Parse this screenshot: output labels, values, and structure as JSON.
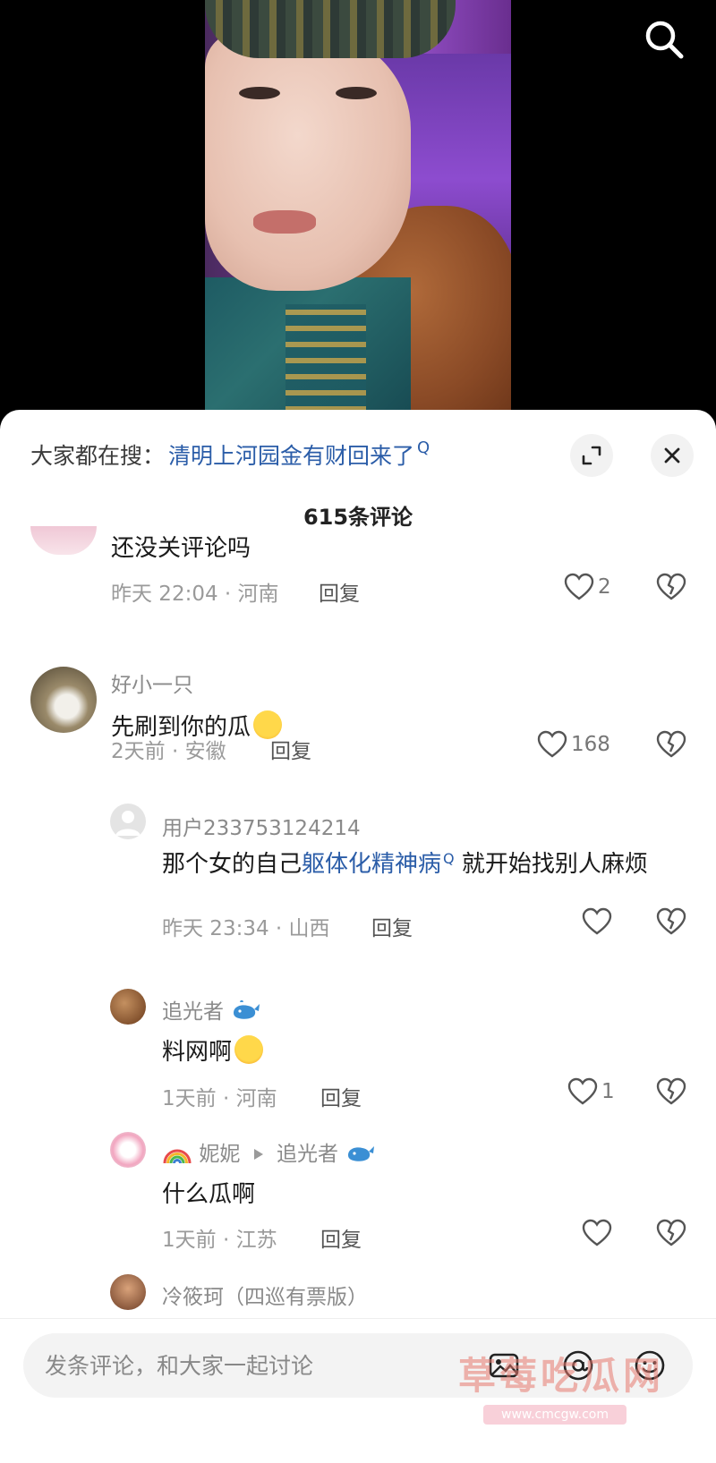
{
  "hot_search": {
    "prefix": "大家都在搜：",
    "term": "清明上河园金有财回来了",
    "search_glyph": "Q"
  },
  "comment_count": "615条评论",
  "comments": [
    {
      "text": "还没关评论吗",
      "time_location": "昨天 22:04 · 河南",
      "reply_label": "回复",
      "likes": "2"
    },
    {
      "username": "好小一只",
      "text": "先刷到你的瓜",
      "time_location": "2天前 · 安徽",
      "reply_label": "回复",
      "likes": "168",
      "replies": [
        {
          "username": "用户233753124214",
          "text_before": "那个女的自己",
          "text_link": "躯体化精神病",
          "text_after": " 就开始找别人麻烦",
          "time_location": "昨天 23:34 · 山西",
          "reply_label": "回复",
          "likes": ""
        },
        {
          "username": "追光者",
          "text": "料网啊",
          "time_location": "1天前 · 河南",
          "reply_label": "回复",
          "likes": "1"
        },
        {
          "username": "妮妮",
          "reply_to": "追光者",
          "text": "什么瓜啊",
          "time_location": "1天前 · 江苏",
          "reply_label": "回复",
          "likes": ""
        },
        {
          "username": "冷筱珂（四巡有票版）"
        }
      ]
    }
  ],
  "input": {
    "placeholder": "发条评论，和大家一起讨论"
  },
  "watermark": {
    "text": "草莓吃瓜网",
    "url": "www.cmcgw.com"
  },
  "colors": {
    "link": "#2b5da8",
    "meta": "#9a9a9a",
    "panel_bg": "#ffffff"
  }
}
